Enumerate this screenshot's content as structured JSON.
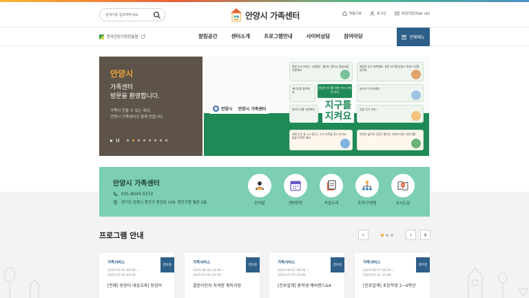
{
  "header": {
    "search_placeholder": "검색어를 입력해주세요",
    "logo_text": "안양시 가족센터",
    "util": [
      "처음으로",
      "로그인",
      "회원가입(Sign up)"
    ]
  },
  "nav": {
    "partner": "한국건강가정진흥원",
    "menu": [
      "알림공간",
      "센터소개",
      "프로그램안내",
      "사이버상담",
      "참여마당"
    ],
    "all_menu": "전체메뉴"
  },
  "hero": {
    "title": "안양시",
    "sub1": "가족센터",
    "sub2": "방문을 환영합니다.",
    "desc1": "가족이 웃을 수 있는 세상,",
    "desc2": "안양시 가족센터가 함께 만듭니다.",
    "slide_count": 8,
    "active_slide": 1,
    "banner": {
      "logo_city": "안양시",
      "logo_center": "안양시 가족센터",
      "badge": "건강한 지구를 위한 우리 가족의 약속",
      "slogan_line1": "지구를",
      "slogan_line2": "지켜요",
      "cards": [
        "한번 쓰고 버리는 1회용컵 · 빨대는 줄이고 텀블러를 사용해요.",
        "깨끗한 공기 회복해요. 푸른 지구를 만들기 위해 나무를 심어요.",
        "에너지를 절약해요.",
        "분리수거 약속해요.",
        "장바구니를 사용해요.",
        "동물 친구 보호!",
        "세계 인구 중 1/4 정도는 식수 부족을 겪고 있어요. 물을 아껴야 해요.",
        "튼튼한 삶으로 건강도 챙기는 자동차 대신 자전거를!"
      ]
    }
  },
  "info": {
    "title": "안양시 가족센터",
    "phone": "031-8045-5572",
    "address": "경기도 안양시 동안구 동안로 158, 동안구청 별관 2층",
    "quick_links": [
      "인사말",
      "센터연혁",
      "사업소개",
      "조직/구성원",
      "오시는길"
    ]
  },
  "programs": {
    "title": "프로그램 안내",
    "page_count": 3,
    "active_page": 0,
    "items": [
      {
        "category": "가족서비스",
        "date1": "2025-07-01 00:00 ~",
        "date2": "2025-07-10 23:59",
        "title": "[전체] 동양이 대상교육] 동양이",
        "status": "접수중"
      },
      {
        "category": "가족서비스",
        "date1": "2025-06-30 14:00 ~",
        "date2": "2025-07-04 22:00",
        "title": "결혼이민자 자격증 취득과정",
        "status": "접수중"
      },
      {
        "category": "가족서비스",
        "date1": "2025-06-27 00:00 ~",
        "date2": "2025-07-25 23:00",
        "title": "[진로설계] 중학생 예비랜드&4",
        "status": "접수중"
      },
      {
        "category": "가족서비스",
        "date1": "2025-06-27 00:00 ~",
        "date2": "2025-07-31 23:00",
        "title": "[진로설계] 초등학생 2~4학년",
        "status": "접수중"
      }
    ]
  },
  "colors": {
    "accent_navy": "#2e5f88",
    "hero_brown": "#5d5348",
    "hero_orange": "#f3a63a",
    "info_mint": "#7ccfb2",
    "banner_green": "#1f8a56"
  }
}
